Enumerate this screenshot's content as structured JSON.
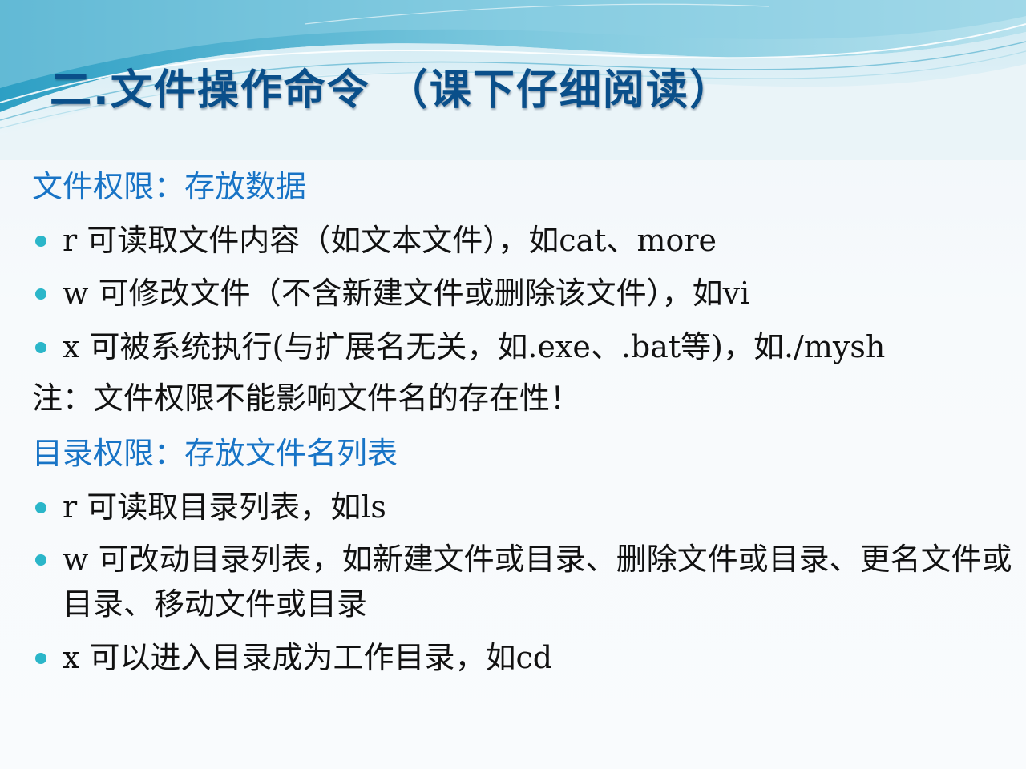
{
  "title": "二.文件操作命令 （课下仔细阅读）",
  "colors": {
    "title": "#0a4f8a",
    "heading": "#1874c6",
    "body_text": "#111111",
    "bullet": "#2bb6c9"
  },
  "file_permissions": {
    "heading": "文件权限：存放数据",
    "items": [
      "r  可读取文件内容（如文本文件），如cat、more",
      "w 可修改文件（不含新建文件或删除该文件），如vi",
      "x 可被系统执行(与扩展名无关，如.exe、.bat等)，如./mysh"
    ],
    "note": "注：文件权限不能影响文件名的存在性！"
  },
  "dir_permissions": {
    "heading": "目录权限：存放文件名列表",
    "items": [
      "r 可读取目录列表，如ls",
      "w 可改动目录列表，如新建文件或目录、删除文件或目录、更名文件或目录、移动文件或目录",
      "x 可以进入目录成为工作目录，如cd"
    ]
  }
}
